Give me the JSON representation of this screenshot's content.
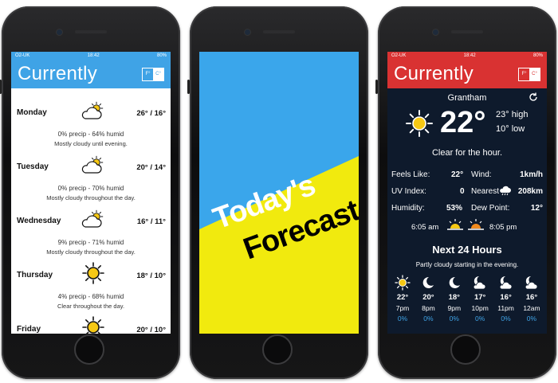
{
  "phone1": {
    "status": {
      "carrier": "O2-UK",
      "time": "18:42",
      "battery": "80%"
    },
    "title": "Currently",
    "unit_f": "F°",
    "unit_c": "C°",
    "days": [
      {
        "name": "Monday",
        "temps": "26° / 16°",
        "stats": "0% precip  -  64% humid",
        "summary": "Mostly cloudy until evening.",
        "icon": "partly-cloudy-icon"
      },
      {
        "name": "Tuesday",
        "temps": "20° / 14°",
        "stats": "0% precip  -  70% humid",
        "summary": "Mostly cloudy throughout the day.",
        "icon": "partly-cloudy-icon"
      },
      {
        "name": "Wednesday",
        "temps": "16° / 11°",
        "stats": "9% precip  -  71% humid",
        "summary": "Mostly cloudy throughout the day.",
        "icon": "partly-cloudy-icon"
      },
      {
        "name": "Thursday",
        "temps": "18° / 10°",
        "stats": "4% precip  -  68% humid",
        "summary": "Clear throughout the day.",
        "icon": "sun-icon"
      },
      {
        "name": "Friday",
        "temps": "20° / 10°",
        "stats": "",
        "summary": "",
        "icon": "sun-icon"
      }
    ],
    "colors": {
      "accent": "#3fa3e6"
    }
  },
  "phone2": {
    "line1": "Today's",
    "line2": "Forecast",
    "colors": {
      "top": "#3aa6eb",
      "bottom": "#f1ea0e"
    }
  },
  "phone3": {
    "status": {
      "carrier": "O2-UK",
      "time": "18:42",
      "battery": "80%"
    },
    "title": "Currently",
    "unit_f": "F°",
    "unit_c": "C°",
    "location": "Grantham",
    "temp": "22°",
    "high": "23° high",
    "low": "10° low",
    "summary": "Clear for the hour.",
    "feels_label": "Feels Like:",
    "feels": "22°",
    "wind_label": "Wind:",
    "wind": "1km/h",
    "uv_label": "UV Index:",
    "uv": "0",
    "nearest_label": "Nearest",
    "nearest": "208km",
    "humidity_label": "Humidity:",
    "humidity": "53%",
    "dew_label": "Dew Point:",
    "dew": "12°",
    "sunrise": "6:05 am",
    "sunset": "8:05 pm",
    "next_title": "Next 24 Hours",
    "next_summary": "Partly cloudy starting in the evening.",
    "hours": [
      {
        "temp": "22°",
        "time": "7pm",
        "pct": "0%",
        "icon": "sun-icon"
      },
      {
        "temp": "20°",
        "time": "8pm",
        "pct": "0%",
        "icon": "moon-icon"
      },
      {
        "temp": "18°",
        "time": "9pm",
        "pct": "0%",
        "icon": "moon-icon"
      },
      {
        "temp": "17°",
        "time": "10pm",
        "pct": "0%",
        "icon": "cloudy-moon-icon"
      },
      {
        "temp": "16°",
        "time": "11pm",
        "pct": "0%",
        "icon": "cloudy-moon-icon"
      },
      {
        "temp": "16°",
        "time": "12am",
        "pct": "0%",
        "icon": "cloudy-moon-icon"
      }
    ],
    "colors": {
      "accent": "#d93232",
      "background": "#0e1a2c",
      "pct": "#3fa3e6"
    }
  }
}
